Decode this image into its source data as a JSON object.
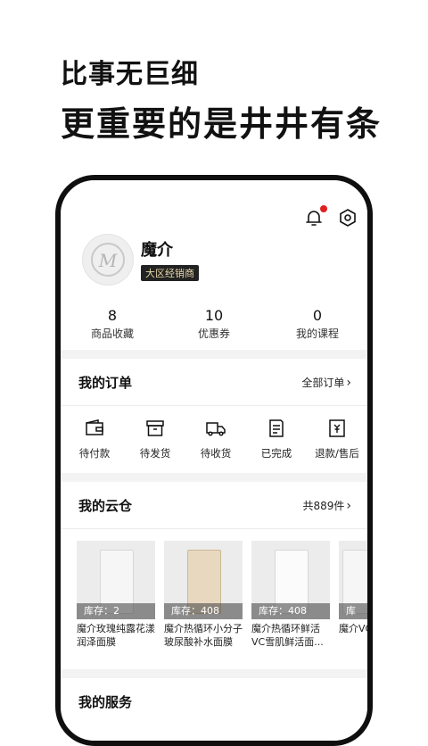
{
  "headline": {
    "line1": "比事无巨细",
    "line2": "更重要的是井井有条"
  },
  "icons": {
    "bell": "bell-icon",
    "settings": "hexagon-settings-icon",
    "accent": "#e02020"
  },
  "profile": {
    "name": "魔介",
    "badge": "大区经销商",
    "avatar_letter": "M"
  },
  "stats": [
    {
      "value": "8",
      "label": "商品收藏"
    },
    {
      "value": "10",
      "label": "优惠券"
    },
    {
      "value": "0",
      "label": "我的课程"
    }
  ],
  "orders": {
    "title": "我的订单",
    "link": "全部订单",
    "items": [
      {
        "label": "待付款",
        "icon": "wallet-icon"
      },
      {
        "label": "待发货",
        "icon": "box-icon"
      },
      {
        "label": "待收货",
        "icon": "truck-icon"
      },
      {
        "label": "已完成",
        "icon": "receipt-icon"
      },
      {
        "label": "退款/售后",
        "icon": "refund-icon"
      }
    ]
  },
  "warehouse": {
    "title": "我的云仓",
    "link": "共889件",
    "products": [
      {
        "stock": "库存：2",
        "name": "魔介玫瑰纯露花漾润泽面膜"
      },
      {
        "stock": "库存：408",
        "name": "魔介热循环小分子玻尿酸补水面膜"
      },
      {
        "stock": "库存：408",
        "name": "魔介热循环鲜活VC雪肌鲜活面..."
      },
      {
        "stock": "库",
        "name": "魔介VC"
      }
    ]
  },
  "services": {
    "title": "我的服务"
  }
}
